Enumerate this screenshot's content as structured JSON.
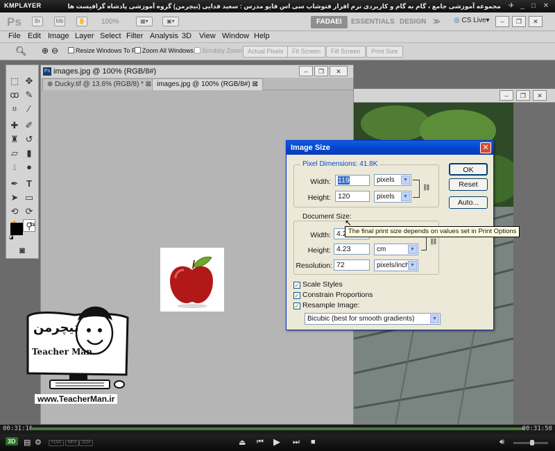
{
  "player": {
    "logo": "KMPLAYER",
    "caption": "مجموعه آموزشی جامع ، گام به گام و کاربردی نرم افزار فتوشاپ سی اس فایو مدرس : سعید فدایی (تیچرمن) گروه آموزشی پادشاه گرافیست ها",
    "elapsed": "00:31:16",
    "remaining": "00:31:50",
    "badge_3d": "3D",
    "pills": [
      "FLVA",
      "MP3",
      "2CH"
    ]
  },
  "appbar": {
    "ps_logo": "Ps",
    "zoom": "100%",
    "workspaces": [
      "FADAEI",
      "ESSENTIALS",
      "DESIGN"
    ],
    "more": "≫",
    "cs_live": "CS Live▾"
  },
  "menu": [
    "File",
    "Edit",
    "Image",
    "Layer",
    "Select",
    "Filter",
    "Analysis",
    "3D",
    "View",
    "Window",
    "Help"
  ],
  "options": {
    "resize_windows": "Resize Windows To Fit",
    "zoom_all": "Zoom All Windows",
    "scrubby": "Scrubby Zoom",
    "buttons": [
      "Actual Pixels",
      "Fit Screen",
      "Fill Screen",
      "Print Size"
    ]
  },
  "document": {
    "title": "images.jpg @ 100% (RGB/8#)",
    "tabs": [
      "Ducky.tif @ 13.6% (RGB/8) *",
      "images.jpg @ 100% (RGB/8#)"
    ]
  },
  "dialog": {
    "title": "Image Size",
    "pixel_dimensions_label": "Pixel Dimensions:",
    "pixel_dimensions_value": "41.8K",
    "width_label": "Width:",
    "height_label": "Height:",
    "px_width": "119",
    "px_height": "120",
    "px_unit": "pixels",
    "doc_size_label": "Document Size:",
    "doc_width": "4.2",
    "doc_height": "4.23",
    "doc_unit": "cm",
    "resolution_label": "Resolution:",
    "resolution": "72",
    "res_unit": "pixels/inch",
    "scale_styles": "Scale Styles",
    "constrain": "Constrain Proportions",
    "resample": "Resample Image:",
    "resample_method": "Bicubic (best for smooth gradients)",
    "ok": "OK",
    "reset": "Reset",
    "auto": "Auto...",
    "tooltip": "The final print size depends on values set in Print Options"
  },
  "watermark": {
    "url": "www.TeacherMan.ir",
    "name": "Teacher Man",
    "persian": "تیچرمن"
  },
  "colors": {
    "dialog_title": "#0a5fe0",
    "workspace": "#6b6b6b"
  }
}
